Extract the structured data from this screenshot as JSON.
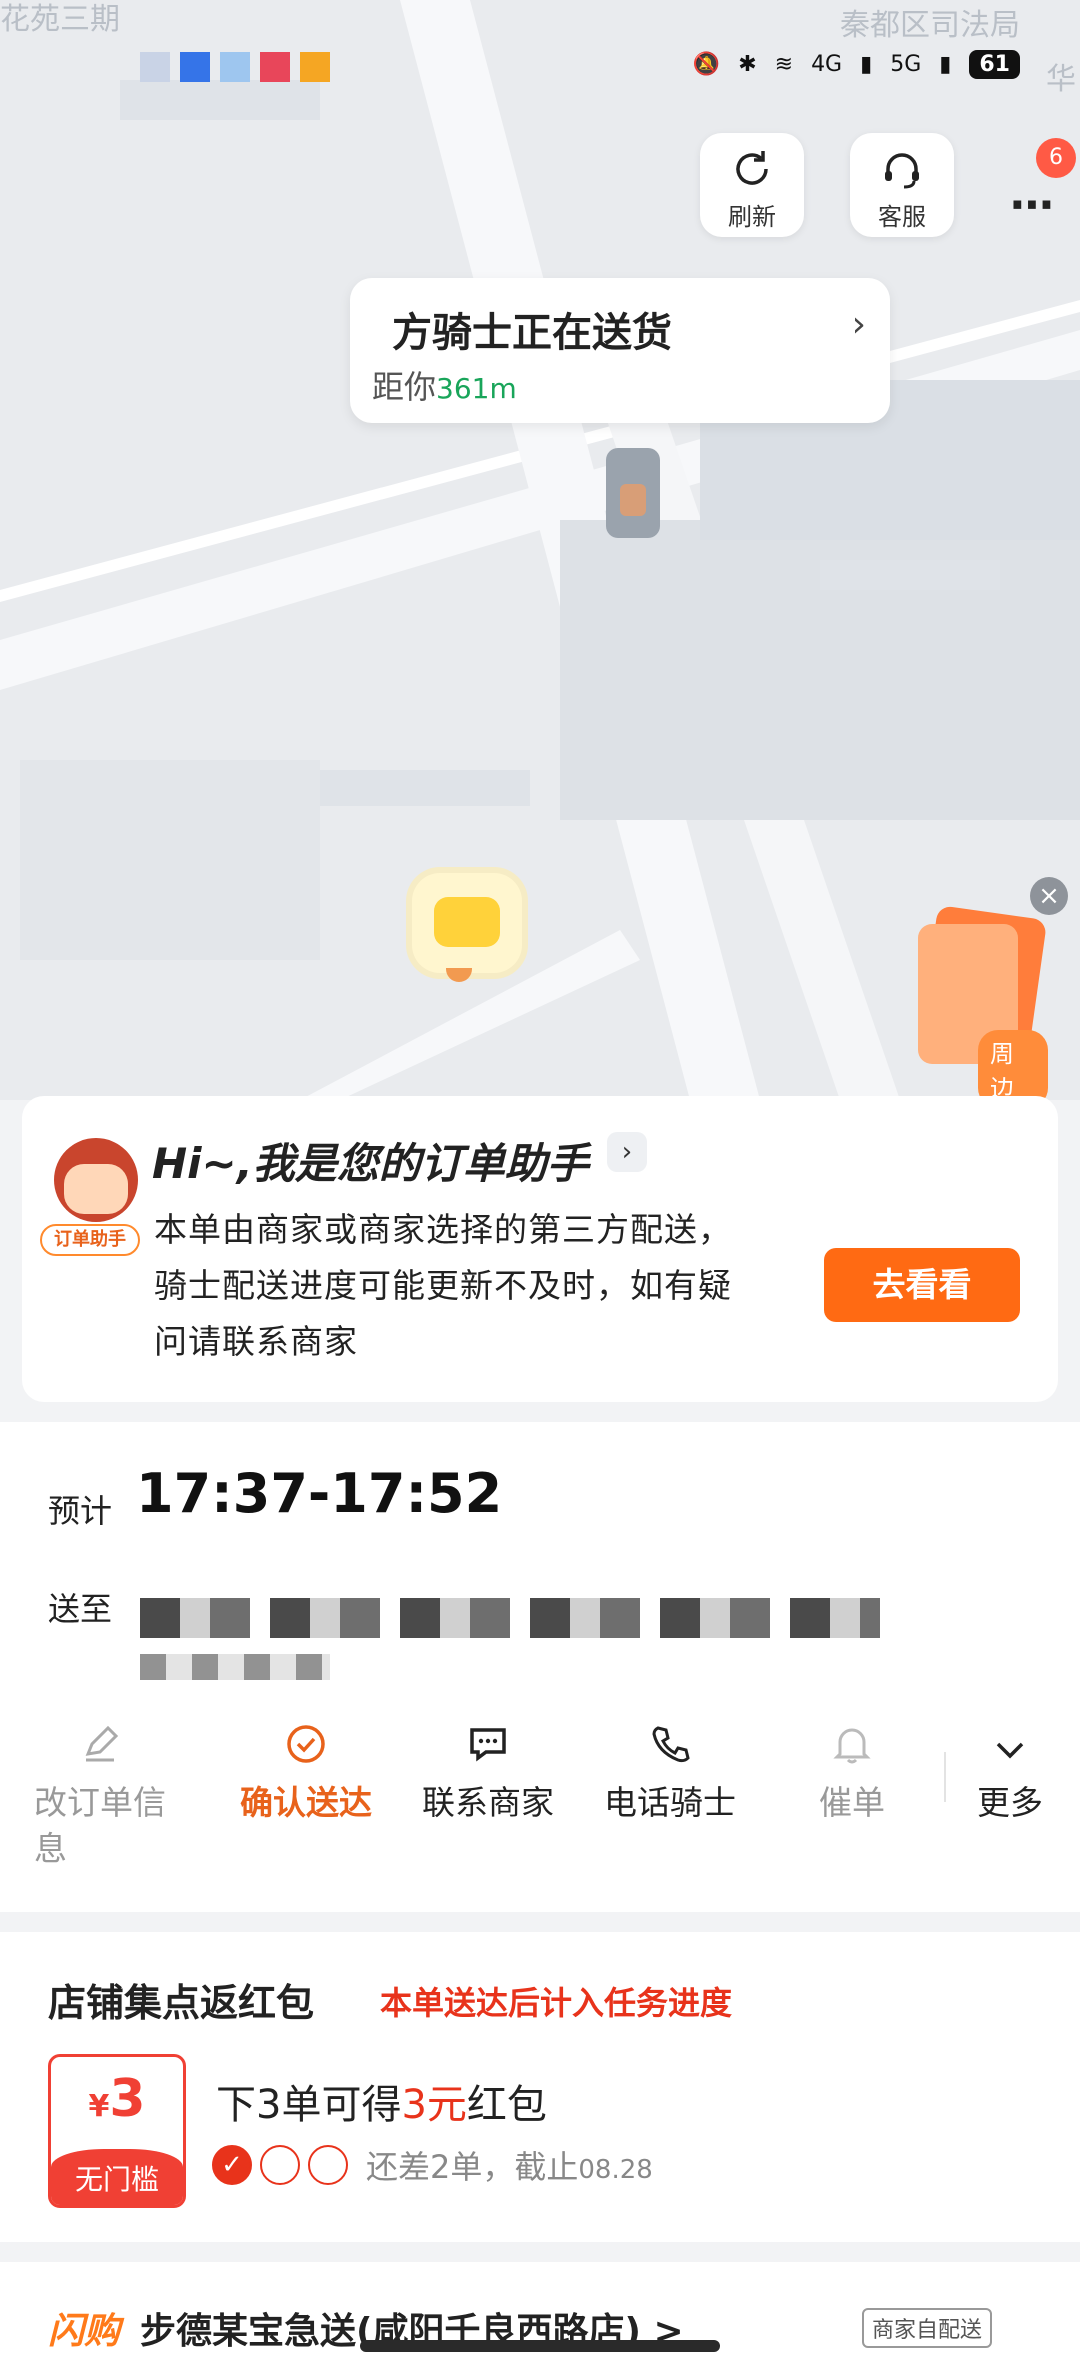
{
  "map": {
    "label_top_left": "花苑三期",
    "label_top_right": "秦都区司法局",
    "label_right_edge": "华"
  },
  "status_bar": {
    "network_4g": "4G",
    "network_5g": "5G",
    "battery": "61"
  },
  "top_buttons": {
    "refresh": "刷新",
    "service": "客服",
    "more_badge": "6"
  },
  "rider": {
    "status": "方骑士正在送货",
    "distance_prefix": "距你",
    "distance_value": "361m"
  },
  "nearby": {
    "label": "周边",
    "close": "×"
  },
  "assistant": {
    "tag": "订单助手",
    "title": "Hi~,我是您的订单助手",
    "body": "本单由商家或商家选择的第三方配送，骑士配送进度可能更新不及时，如有疑问请联系商家",
    "button": "去看看"
  },
  "order": {
    "eta_label": "预计",
    "eta_value": "17:37-17:52",
    "address_label": "送至",
    "actions": [
      {
        "label": "改订单信息",
        "icon": "edit-icon"
      },
      {
        "label": "确认送达",
        "icon": "check-circle-icon"
      },
      {
        "label": "联系商家",
        "icon": "chat-icon"
      },
      {
        "label": "电话骑士",
        "icon": "phone-icon"
      },
      {
        "label": "催单",
        "icon": "bell-icon"
      },
      {
        "label": "更多",
        "icon": "chevron-down-icon"
      }
    ]
  },
  "red_packet": {
    "title": "店铺集点返红包",
    "subtitle": "本单送达后计入任务进度",
    "coupon_currency": "¥",
    "coupon_amount": "3",
    "coupon_condition": "无门槛",
    "line_prefix": "下3单可得",
    "line_amount": "3元",
    "line_suffix": "红包",
    "progress_text": "还差2单，截止",
    "progress_date": "08.28",
    "progress_done": 1,
    "progress_total": 3
  },
  "shop": {
    "logo": "闪购",
    "name": "步德某宝急送(咸阳千良西路店) >",
    "tag": "商家自配送"
  }
}
